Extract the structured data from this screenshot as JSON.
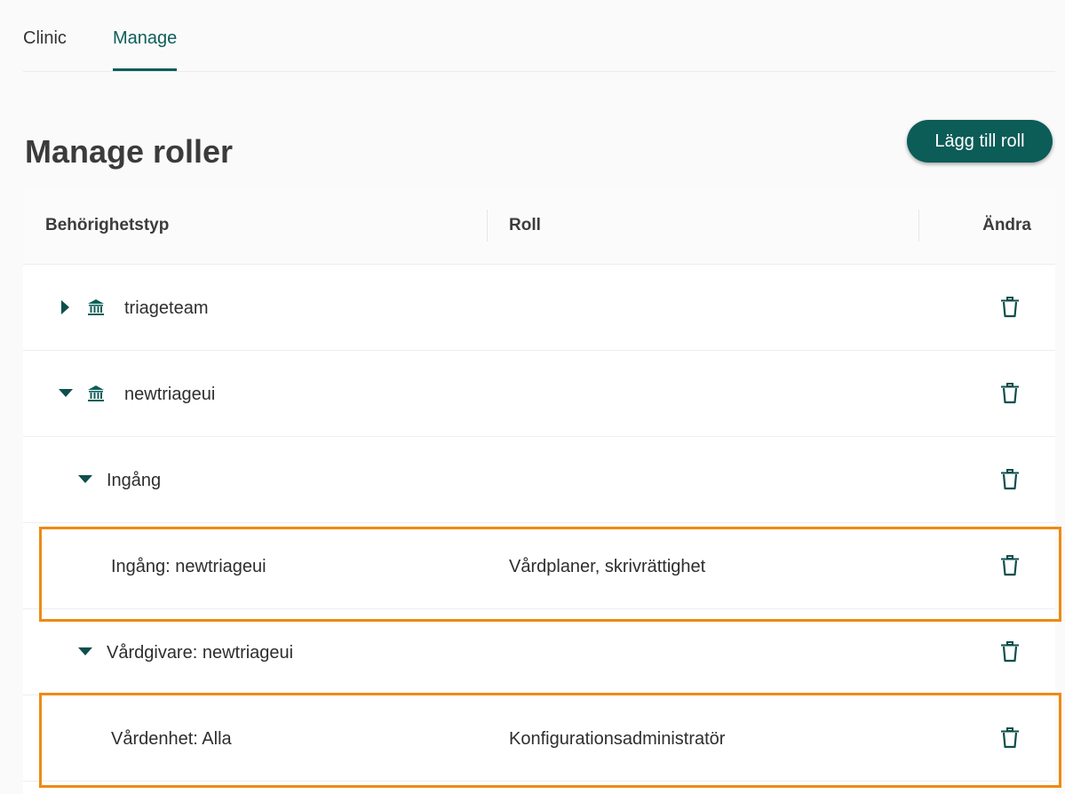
{
  "tabs": [
    {
      "label": "Clinic",
      "active": false
    },
    {
      "label": "Manage",
      "active": true
    }
  ],
  "page": {
    "title": "Manage roller",
    "add_button_label": "Lägg till roll"
  },
  "table": {
    "columns": [
      "Behörighetstyp",
      "Roll",
      "Ändra"
    ],
    "rows": [
      {
        "name": "triageteam",
        "role": "",
        "icon": "bank-icon",
        "expanded": false
      },
      {
        "name": "newtriageui",
        "role": "",
        "icon": "bank-icon",
        "expanded": true
      },
      {
        "name": "Ingång",
        "role": "",
        "expanded": true
      },
      {
        "name": "Ingång: newtriageui",
        "role": "Vårdplaner, skrivrättighet",
        "highlighted": true
      },
      {
        "name": "Vårdgivare: newtriageui",
        "role": "",
        "expanded": true
      },
      {
        "name": "Vårdenhet: Alla",
        "role": "Konfigurationsadministratör",
        "highlighted": true
      }
    ]
  },
  "colors": {
    "accent": "#0d5e5a",
    "highlight": "#ee8a12"
  }
}
